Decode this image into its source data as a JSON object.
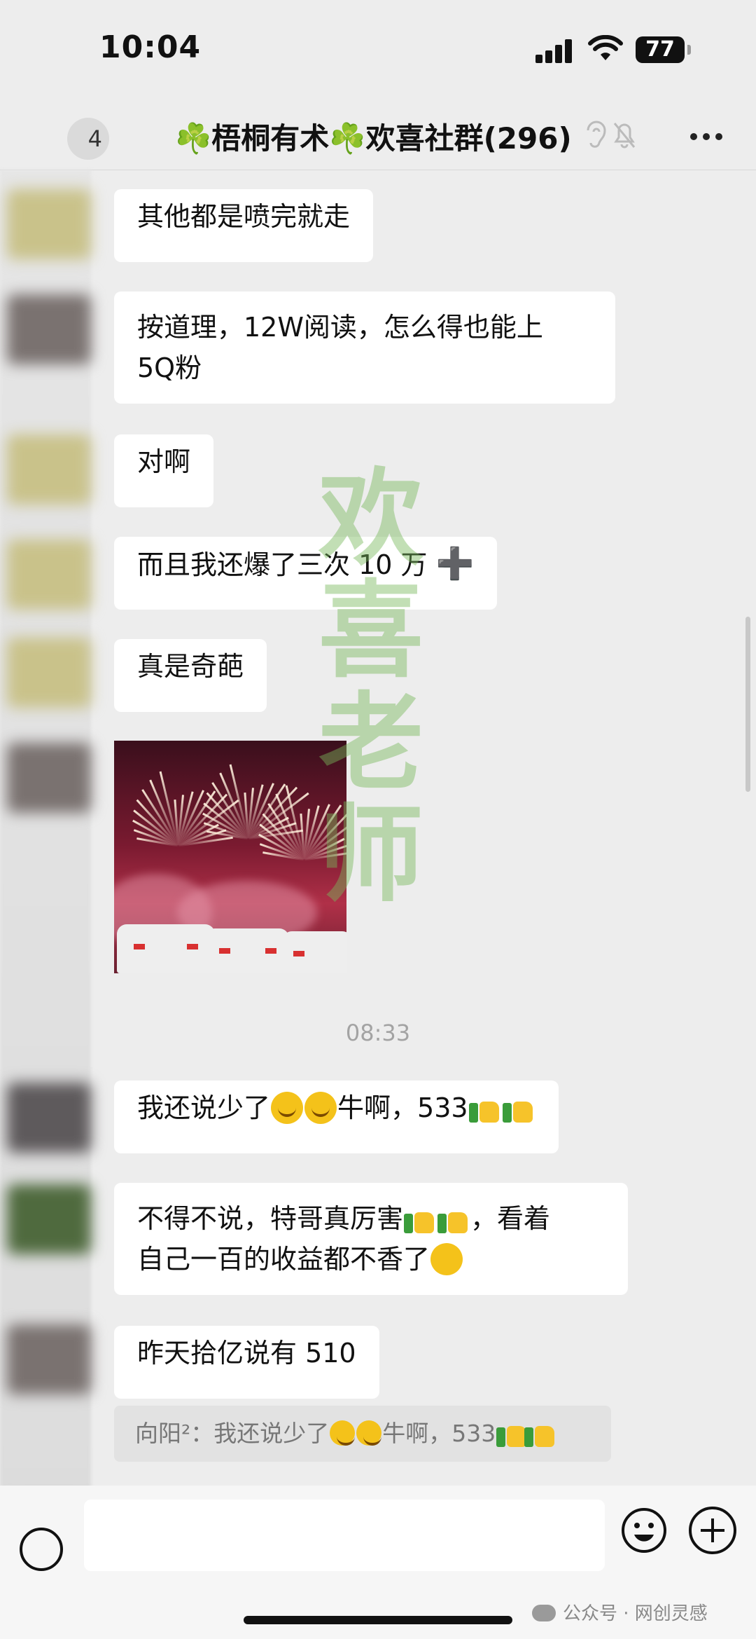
{
  "status_bar": {
    "time": "10:04",
    "battery": "77"
  },
  "header": {
    "back_badge": "4",
    "title": "☘️梧桐有术☘️欢喜社群(296)",
    "icons": [
      "ear-icon",
      "mute-icon",
      "more-icon"
    ]
  },
  "messages": [
    {
      "text": "其他都是喷完就走"
    },
    {
      "line1": "按道理，12W阅读，怎么得也能上",
      "line2": "5Q粉"
    },
    {
      "text": "对啊"
    },
    {
      "text": "而且我还爆了三次 10 万",
      "suffix": "➕"
    },
    {
      "text": "真是奇葩"
    },
    {
      "type": "image",
      "description_icon": "fireworks-photo"
    },
    {
      "prefix": "我还说少了",
      "middle": "牛啊，533"
    },
    {
      "line1_a": "不得不说，特哥真厉害",
      "line1_b": "，看着",
      "line2": "自己一百的收益都不香了"
    },
    {
      "text": "昨天拾亿说有 510"
    }
  ],
  "timestamp": "08:33",
  "quote": {
    "prefix": "向阳²：我还说少了",
    "middle": "牛啊，533"
  },
  "watermark": [
    "欢",
    "喜",
    "老",
    "师"
  ],
  "footer": {
    "credit": "公众号 · 网创灵感"
  },
  "colors": {
    "background": "#ededed",
    "bubble": "#ffffff",
    "watermark": "#78b95a"
  }
}
